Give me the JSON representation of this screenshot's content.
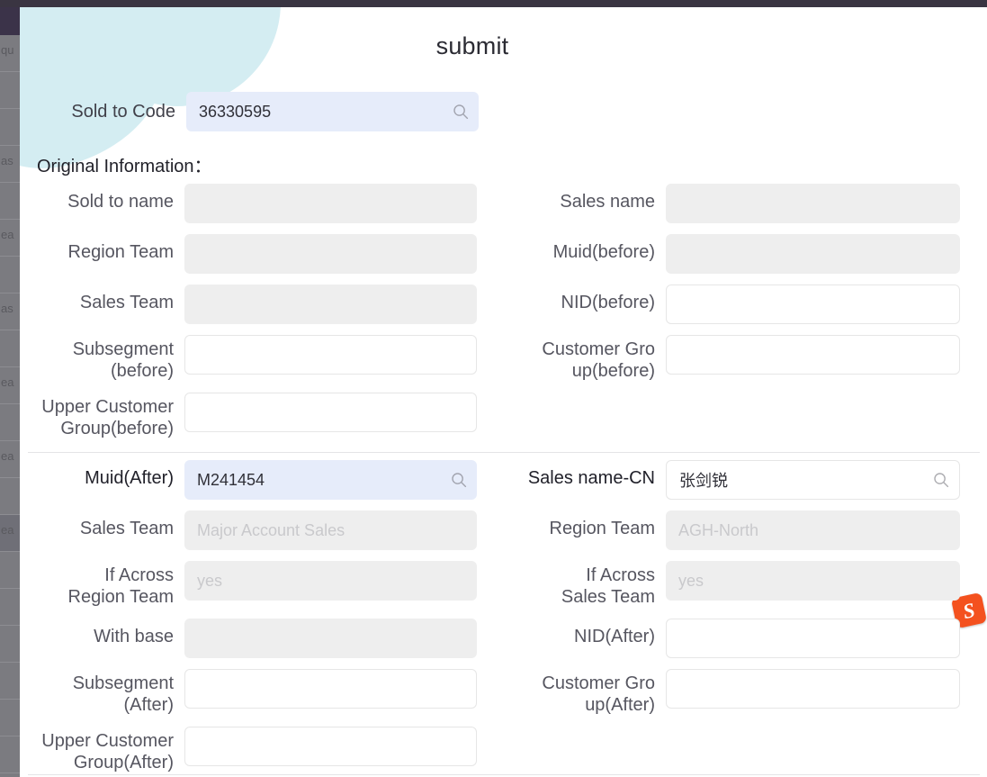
{
  "window": {
    "topbar_color": "#3a3542",
    "backdrop_color": "#7b7b80",
    "accent_teal": "#d4edf2",
    "highlight_field_color": "#e6ecfa",
    "disabled_field_color": "#eeeeee"
  },
  "backdrop": {
    "rows": [
      "qu",
      "",
      "",
      "as",
      "",
      "ea",
      "",
      "as",
      "",
      "ea",
      "",
      "ea",
      "",
      "ea",
      "",
      "",
      "",
      "",
      "",
      ""
    ]
  },
  "modal": {
    "title": "submit",
    "sold_to_code": {
      "label": "Sold to Code",
      "value": "36330595",
      "icon": "search-icon"
    },
    "original_section": {
      "heading": "Original Information：",
      "rows": [
        {
          "left": {
            "label": "Sold to name",
            "value": "",
            "state": "disabled"
          },
          "right": {
            "label": "Sales name",
            "value": "",
            "state": "disabled"
          }
        },
        {
          "left": {
            "label": "Region Team",
            "value": "",
            "state": "disabled"
          },
          "right": {
            "label": "Muid(before)",
            "value": "",
            "state": "disabled"
          }
        },
        {
          "left": {
            "label": "Sales Team",
            "value": "",
            "state": "disabled"
          },
          "right": {
            "label": "NID(before)",
            "value": "",
            "state": "plain"
          }
        },
        {
          "left": {
            "label": "Subsegment\n(before)",
            "value": "",
            "state": "plain"
          },
          "right": {
            "label": "Customer Gro\nup(before)",
            "value": "",
            "state": "plain"
          }
        },
        {
          "left": {
            "label": "Upper Customer\nGroup(before)",
            "value": "",
            "state": "plain"
          },
          "right": {
            "label": "",
            "value": "",
            "state": "none"
          }
        }
      ]
    },
    "after_section": {
      "rows": [
        {
          "left": {
            "label": "Muid(After)",
            "value": "M241454",
            "state": "highlight",
            "icon": "search-icon",
            "strong": true
          },
          "right": {
            "label": "Sales name-CN",
            "value": "张剑锐",
            "state": "plain",
            "icon": "search-icon",
            "strong": true
          }
        },
        {
          "left": {
            "label": "Sales Team",
            "value": "Major Account Sales",
            "state": "disabled",
            "placeholder": true
          },
          "right": {
            "label": "Region Team",
            "value": "AGH-North",
            "state": "disabled",
            "placeholder": true
          }
        },
        {
          "left": {
            "label": "If Across\nRegion Team",
            "value": "yes",
            "state": "disabled",
            "placeholder": true
          },
          "right": {
            "label": "If Across\nSales Team",
            "value": "yes",
            "state": "disabled",
            "placeholder": true
          }
        },
        {
          "left": {
            "label": "With base",
            "value": "",
            "state": "disabled"
          },
          "right": {
            "label": "NID(After)",
            "value": "",
            "state": "plain"
          }
        },
        {
          "left": {
            "label": "Subsegment\n(After)",
            "value": "",
            "state": "plain"
          },
          "right": {
            "label": "Customer Gro\nup(After)",
            "value": "",
            "state": "plain"
          }
        },
        {
          "left": {
            "label": "Upper Customer\nGroup(After)",
            "value": "",
            "state": "plain"
          },
          "right": {
            "label": "",
            "value": "",
            "state": "none"
          }
        }
      ]
    }
  },
  "ime": {
    "name": "sogou-ime-icon",
    "glyph": "S",
    "color": "#f4511e"
  }
}
